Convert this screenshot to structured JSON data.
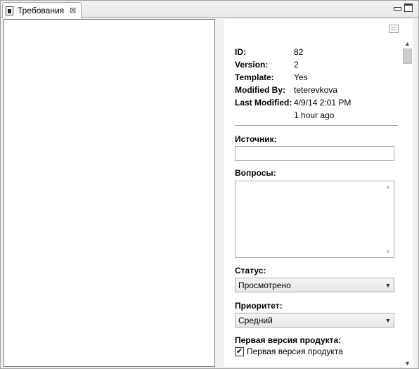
{
  "tab": {
    "title": "Требования"
  },
  "meta": {
    "id_label": "ID:",
    "id_value": "82",
    "version_label": "Version:",
    "version_value": "2",
    "template_label": "Template:",
    "template_value": "Yes",
    "modified_by_label": "Modified By:",
    "modified_by_value": "teterevkova",
    "last_modified_label": "Last Modified:",
    "last_modified_value": "4/9/14 2:01 PM",
    "last_modified_relative": "1 hour ago"
  },
  "form": {
    "source_label": "Источник:",
    "source_value": "",
    "questions_label": "Вопросы:",
    "questions_value": "",
    "status_label": "Статус:",
    "status_value": "Просмотрено",
    "priority_label": "Приоритет:",
    "priority_value": "Средний",
    "first_version_label": "Первая версия продукта:",
    "first_version_checkbox_label": "Первая версия продукта",
    "first_version_checked": true
  },
  "icons": {
    "tab_icon": "requirements-icon",
    "tab_close": "close-icon",
    "minimize": "minimize-icon",
    "maximize": "maximize-icon",
    "document": "document-icon",
    "dropdown": "chevron-down-icon",
    "check": "checkmark-icon"
  }
}
